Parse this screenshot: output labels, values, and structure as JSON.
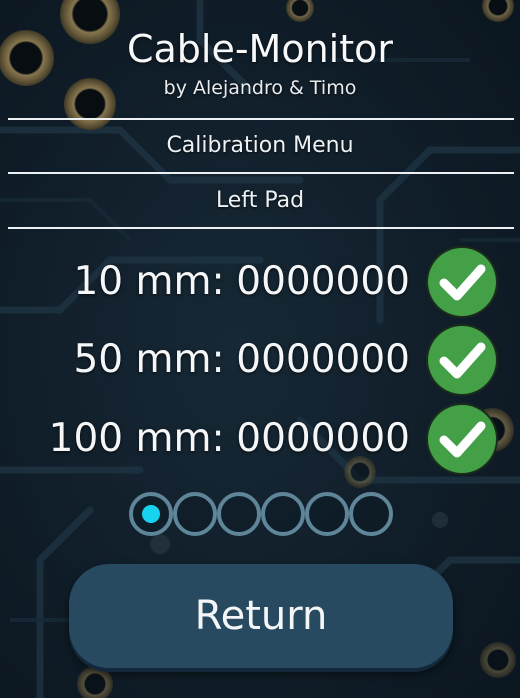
{
  "header": {
    "title": "Cable-Monitor",
    "subtitle": "by Alejandro & Timo"
  },
  "menu": {
    "section": "Calibration Menu",
    "pad": "Left Pad"
  },
  "calibration": [
    {
      "label": "10 mm:",
      "value": "0000000",
      "status_icon": "check-circle-icon"
    },
    {
      "label": "50 mm:",
      "value": "0000000",
      "status_icon": "check-circle-icon"
    },
    {
      "label": "100 mm:",
      "value": "0000000",
      "status_icon": "check-circle-icon"
    }
  ],
  "pager": {
    "total": 6,
    "current": 1
  },
  "return_button": {
    "label": "Return"
  },
  "colors": {
    "check_green": "#43a047",
    "dot_active": "#17d3f0",
    "dot_ring": "#5f8598",
    "button": "#274a60"
  }
}
